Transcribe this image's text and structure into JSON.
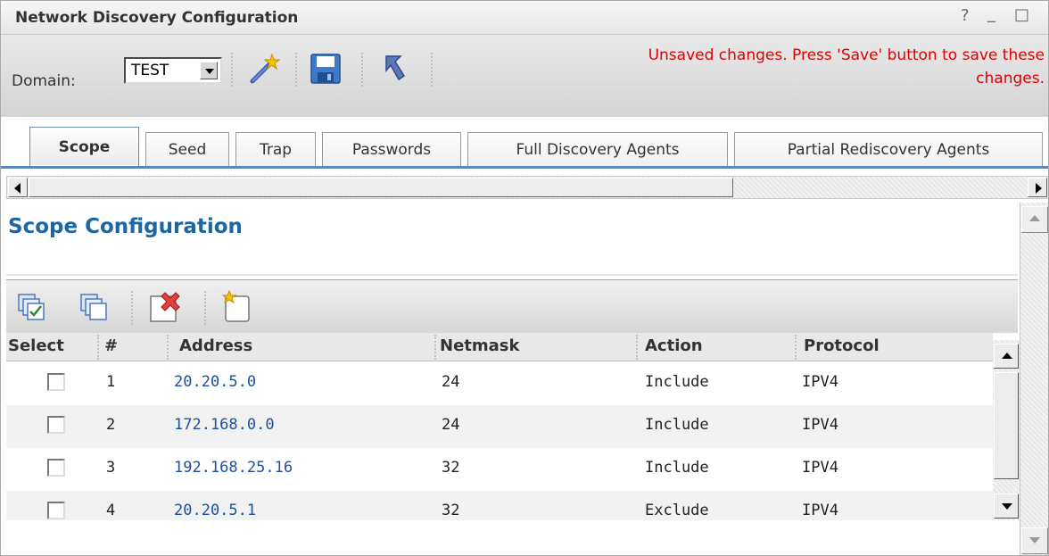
{
  "window": {
    "title": "Network Discovery Configuration",
    "help_glyph": "?",
    "minimize_glyph": "_",
    "maximize_glyph": "□"
  },
  "toolbar": {
    "domain_label": "Domain:",
    "domain_value": "TEST",
    "icons": [
      "magic-wand-icon",
      "save-icon",
      "undo-arrow-icon"
    ],
    "unsaved_message_line1": "Unsaved changes. Press 'Save' button to save these",
    "unsaved_message_line2": "changes.",
    "message_color": "#e00000"
  },
  "tabs": [
    {
      "label": "Scope",
      "active": true
    },
    {
      "label": "Seed",
      "active": false
    },
    {
      "label": "Trap",
      "active": false
    },
    {
      "label": "Passwords",
      "active": false
    },
    {
      "label": "Full Discovery Agents",
      "active": false
    },
    {
      "label": "Partial Rediscovery Agents",
      "active": false
    }
  ],
  "main": {
    "heading": "Scope Configuration",
    "heading_color": "#1c67a3",
    "table_toolbar_icons": [
      "select-all-icon",
      "deselect-all-icon",
      "delete-icon",
      "new-icon"
    ],
    "columns": [
      "Select",
      "#",
      "Address",
      "Netmask",
      "Action",
      "Protocol"
    ],
    "rows": [
      {
        "index": "1",
        "address": "20.20.5.0",
        "netmask": "24",
        "action": "Include",
        "protocol": "IPV4",
        "selected": false
      },
      {
        "index": "2",
        "address": "172.168.0.0",
        "netmask": "24",
        "action": "Include",
        "protocol": "IPV4",
        "selected": false
      },
      {
        "index": "3",
        "address": "192.168.25.16",
        "netmask": "32",
        "action": "Include",
        "protocol": "IPV4",
        "selected": false
      },
      {
        "index": "4",
        "address": "20.20.5.1",
        "netmask": "32",
        "action": "Exclude",
        "protocol": "IPV4",
        "selected": false
      }
    ],
    "address_link_color": "#1e4fa3"
  }
}
